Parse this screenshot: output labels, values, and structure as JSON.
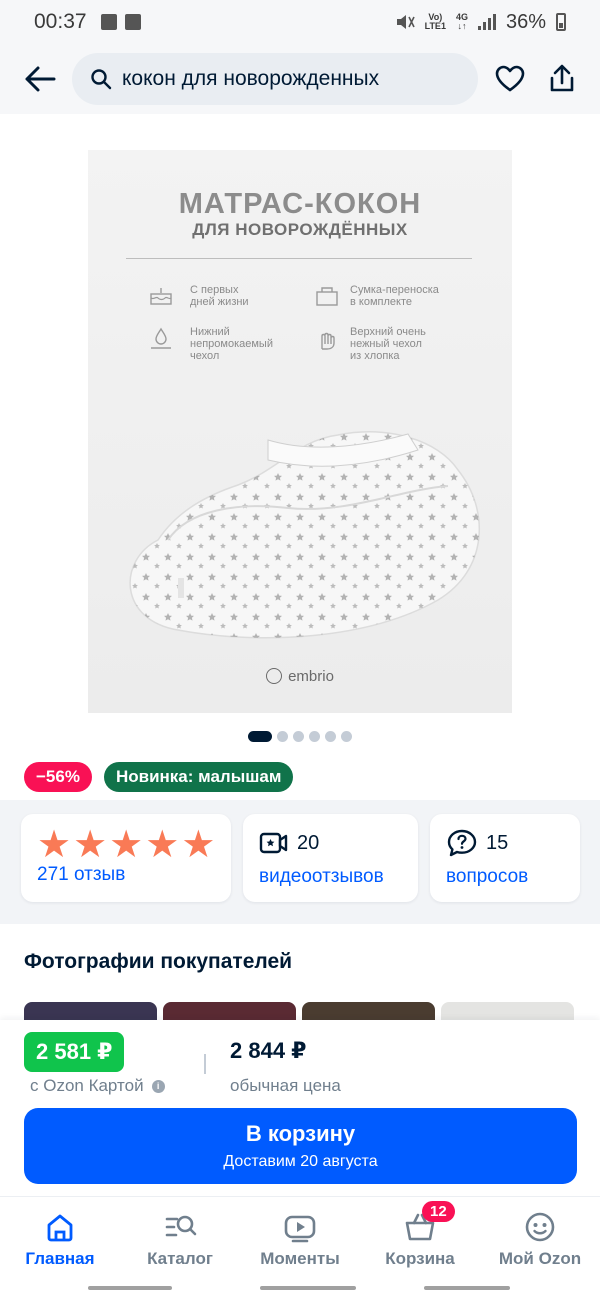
{
  "status_bar": {
    "time": "00:37",
    "network_top": "Vo)",
    "network_bottom": "LTE1",
    "data_top": "4G",
    "data_bottom": "↓↑",
    "battery": "36%"
  },
  "top_bar": {
    "search_query": "кокон для новорожденных",
    "icons": [
      "back-arrow-icon",
      "search-icon",
      "heart-icon",
      "share-icon"
    ]
  },
  "product_image": {
    "title": "МАТРАС-КОКОН",
    "subtitle": "ДЛЯ НОВОРОЖДЁННЫХ",
    "features": [
      {
        "line1": "С первых",
        "line2": "дней жизни",
        "line3": ""
      },
      {
        "line1": "Сумка-переноска",
        "line2": "в комплекте",
        "line3": ""
      },
      {
        "line1": "Нижний",
        "line2": "непромокаемый",
        "line3": "чехол"
      },
      {
        "line1": "Верхний очень",
        "line2": "нежный чехол",
        "line3": "из хлопка"
      }
    ],
    "brand": "embrio"
  },
  "pager": {
    "total": 6,
    "active": 1
  },
  "badges": {
    "discount": "−56%",
    "new": "Новинка: малышам"
  },
  "stats": {
    "rating": 5,
    "reviews": "271 отзыв",
    "video_count": "20",
    "video_label": "видеоотзывов",
    "questions_count": "15",
    "questions_label": "вопросов"
  },
  "section": {
    "title": "Фотографии покупателей"
  },
  "price": {
    "card_price": "2 581 ₽",
    "card_label": "с Ozon Картой",
    "regular_price": "2 844 ₽",
    "regular_label": "обычная цена"
  },
  "cart_button": {
    "title": "В корзину",
    "subtitle": "Доставим 20 августа"
  },
  "bottom_nav": {
    "items": [
      {
        "label": "Главная"
      },
      {
        "label": "Каталог"
      },
      {
        "label": "Моменты"
      },
      {
        "label": "Корзина"
      },
      {
        "label": "Мой Ozon"
      }
    ],
    "cart_badge": "12"
  },
  "colors": {
    "accent": "#005bff",
    "discount": "#f91155",
    "new_badge": "#10734a",
    "ozon_card_price": "#10c44c",
    "rating_star": "#f97a56"
  }
}
